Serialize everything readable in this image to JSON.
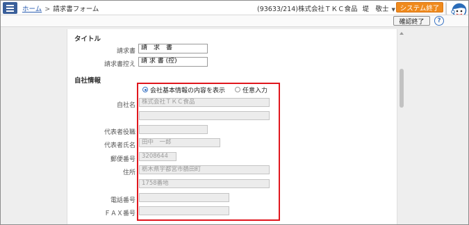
{
  "header": {
    "breadcrumb_home": "ホーム",
    "breadcrumb_sep": ">",
    "breadcrumb_current": "請求書フォーム",
    "company_info": "(93633/214)株式会社ＴＫＣ食品",
    "user_name": "堤　敬士",
    "user_caret": "▼",
    "system_exit_label": "システム終了"
  },
  "subbar": {
    "confirm_exit_label": "確認終了",
    "help_glyph": "?"
  },
  "title_section": {
    "heading": "タイトル",
    "invoice_label": "請求書",
    "invoice_value": "請　求　書",
    "copy_label": "請求書控え",
    "copy_value": "請 求 書 (控)"
  },
  "company_section": {
    "heading": "自社情報",
    "radio_basic": "会社基本情報の内容を表示",
    "radio_manual": "任意入力",
    "company_name_label": "自社名",
    "company_name_1": "株式会社ＴＫＣ食品",
    "company_name_2": "",
    "rep_title_label": "代表者役職",
    "rep_title_value": "",
    "rep_name_label": "代表者氏名",
    "rep_name_value": "田中　一郎",
    "zip_label": "郵便番号",
    "zip_value": "3208644",
    "address_label": "住所",
    "address_1": "栃木県宇都宮市鶴田町",
    "address_2": "1758番地",
    "phone_label": "電話番号",
    "phone_value": "",
    "fax_label": "ＦＡＸ番号",
    "fax_value": ""
  },
  "colors": {
    "accent_blue": "#3a5f9a",
    "orange_button": "#ef8a1d",
    "highlight_red": "#e0161d"
  }
}
